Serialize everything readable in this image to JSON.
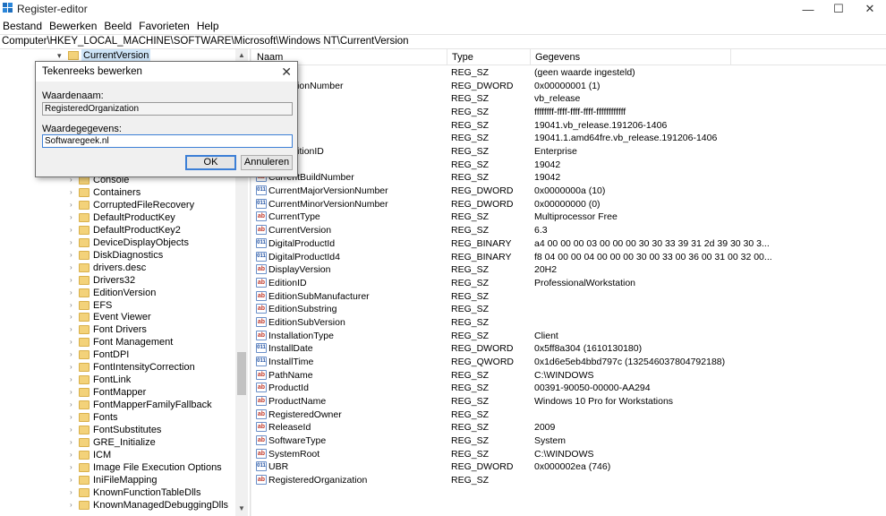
{
  "window": {
    "title": "Register-editor"
  },
  "menu": [
    "Bestand",
    "Bewerken",
    "Beeld",
    "Favorieten",
    "Help"
  ],
  "address": "Computer\\HKEY_LOCAL_MACHINE\\SOFTWARE\\Microsoft\\Windows NT\\CurrentVersion",
  "tree": {
    "selected": "CurrentVersion",
    "items": [
      "Console",
      "Containers",
      "CorruptedFileRecovery",
      "DefaultProductKey",
      "DefaultProductKey2",
      "DeviceDisplayObjects",
      "DiskDiagnostics",
      "drivers.desc",
      "Drivers32",
      "EditionVersion",
      "EFS",
      "Event Viewer",
      "Font Drivers",
      "Font Management",
      "FontDPI",
      "FontIntensityCorrection",
      "FontLink",
      "FontMapper",
      "FontMapperFamilyFallback",
      "Fonts",
      "FontSubstitutes",
      "GRE_Initialize",
      "ICM",
      "Image File Execution Options",
      "IniFileMapping",
      "KnownFunctionTableDlls",
      "KnownManagedDebuggingDlls"
    ]
  },
  "list": {
    "headers": {
      "name": "Naam",
      "type": "Type",
      "data": "Gegevens"
    },
    "rows": [
      {
        "name": "rd)",
        "type": "REG_SZ",
        "data": "(geen waarde ingesteld)",
        "icon": "ab"
      },
      {
        "name": "dRevisionNumber",
        "type": "REG_DWORD",
        "data": "0x00000001 (1)",
        "icon": "bin"
      },
      {
        "name": "nch",
        "type": "REG_SZ",
        "data": "vb_release",
        "icon": "ab"
      },
      {
        "name": "ID",
        "type": "REG_SZ",
        "data": "ffffffff-ffff-ffff-ffff-ffffffffffff",
        "icon": "ab"
      },
      {
        "name": "",
        "type": "REG_SZ",
        "data": "19041.vb_release.191206-1406",
        "icon": "ab"
      },
      {
        "name": "Ex",
        "type": "REG_SZ",
        "data": "19041.1.amd64fre.vb_release.191206-1406",
        "icon": "ab"
      },
      {
        "name": "itionEditionID",
        "type": "REG_SZ",
        "data": "Enterprise",
        "icon": "ab"
      },
      {
        "name": "Build",
        "type": "REG_SZ",
        "data": "19042",
        "icon": "ab"
      },
      {
        "name": "CurrentBuildNumber",
        "type": "REG_SZ",
        "data": "19042",
        "icon": "ab"
      },
      {
        "name": "CurrentMajorVersionNumber",
        "type": "REG_DWORD",
        "data": "0x0000000a (10)",
        "icon": "bin"
      },
      {
        "name": "CurrentMinorVersionNumber",
        "type": "REG_DWORD",
        "data": "0x00000000 (0)",
        "icon": "bin"
      },
      {
        "name": "CurrentType",
        "type": "REG_SZ",
        "data": "Multiprocessor Free",
        "icon": "ab"
      },
      {
        "name": "CurrentVersion",
        "type": "REG_SZ",
        "data": "6.3",
        "icon": "ab"
      },
      {
        "name": "DigitalProductId",
        "type": "REG_BINARY",
        "data": "a4 00 00 00 03 00 00 00 30 30 33 39 31 2d 39 30 30 3...",
        "icon": "bin"
      },
      {
        "name": "DigitalProductId4",
        "type": "REG_BINARY",
        "data": "f8 04 00 00 04 00 00 00 30 00 33 00 36 00 31 00 32 00...",
        "icon": "bin"
      },
      {
        "name": "DisplayVersion",
        "type": "REG_SZ",
        "data": "20H2",
        "icon": "ab"
      },
      {
        "name": "EditionID",
        "type": "REG_SZ",
        "data": "ProfessionalWorkstation",
        "icon": "ab"
      },
      {
        "name": "EditionSubManufacturer",
        "type": "REG_SZ",
        "data": "",
        "icon": "ab"
      },
      {
        "name": "EditionSubstring",
        "type": "REG_SZ",
        "data": "",
        "icon": "ab"
      },
      {
        "name": "EditionSubVersion",
        "type": "REG_SZ",
        "data": "",
        "icon": "ab"
      },
      {
        "name": "InstallationType",
        "type": "REG_SZ",
        "data": "Client",
        "icon": "ab"
      },
      {
        "name": "InstallDate",
        "type": "REG_DWORD",
        "data": "0x5ff8a304 (1610130180)",
        "icon": "bin"
      },
      {
        "name": "InstallTime",
        "type": "REG_QWORD",
        "data": "0x1d6e5eb4bbd797c (132546037804792188)",
        "icon": "bin"
      },
      {
        "name": "PathName",
        "type": "REG_SZ",
        "data": "C:\\WINDOWS",
        "icon": "ab"
      },
      {
        "name": "ProductId",
        "type": "REG_SZ",
        "data": "00391-90050-00000-AA294",
        "icon": "ab"
      },
      {
        "name": "ProductName",
        "type": "REG_SZ",
        "data": "Windows 10 Pro for Workstations",
        "icon": "ab"
      },
      {
        "name": "RegisteredOwner",
        "type": "REG_SZ",
        "data": "",
        "icon": "ab"
      },
      {
        "name": "ReleaseId",
        "type": "REG_SZ",
        "data": "2009",
        "icon": "ab"
      },
      {
        "name": "SoftwareType",
        "type": "REG_SZ",
        "data": "System",
        "icon": "ab"
      },
      {
        "name": "SystemRoot",
        "type": "REG_SZ",
        "data": "C:\\WINDOWS",
        "icon": "ab"
      },
      {
        "name": "UBR",
        "type": "REG_DWORD",
        "data": "0x000002ea (746)",
        "icon": "bin"
      },
      {
        "name": "RegisteredOrganization",
        "type": "REG_SZ",
        "data": "",
        "icon": "ab"
      }
    ]
  },
  "dialog": {
    "title": "Tekenreeks bewerken",
    "name_label": "Waardenaam:",
    "name_value": "RegisteredOrganization",
    "data_label": "Waardegegevens:",
    "data_value": "Softwaregeek.nl",
    "ok": "OK",
    "cancel": "Annuleren"
  }
}
